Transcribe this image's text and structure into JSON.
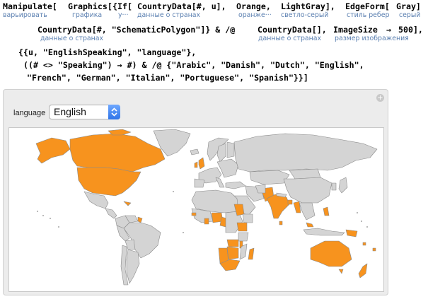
{
  "notebook": {
    "code_lines": [
      [
        "Manipulate[",
        "Graphics[",
        "{If[",
        "CountryData[#, u], ",
        "Orange, ",
        "LightGray], ",
        "EdgeForm[",
        "Gray]"
      ],
      [
        "CountryData[#, \"SchematicPolygon\"]} & /@ ",
        "CountryData[], ",
        "ImageSize",
        " → ",
        "500],"
      ],
      [
        "{{u, \"EnglishSpeaking\", \"language\"},"
      ],
      [
        "((# <> \"Speaking\") → #) & /@ {\"Arabic\", \"Danish\", \"Dutch\", \"English\","
      ],
      [
        "\"French\", \"German\", \"Italian\", \"Portuguese\", \"Spanish\"}}]"
      ]
    ],
    "hints_line1": [
      "варьировать",
      "графика",
      "у···",
      "данные о странах",
      "оранже···",
      "светло-серый",
      "стиль ребер",
      "серый"
    ],
    "hints_line2": [
      "данные о странах",
      "данные о странах",
      "размер изображения"
    ]
  },
  "manipulate": {
    "control_label": "language",
    "selected_value": "English",
    "close_icon": "plus-circle-icon",
    "colors": {
      "highlight": "#f7931e",
      "land": "#d4d4d4",
      "border": "#8a8a8a"
    }
  }
}
